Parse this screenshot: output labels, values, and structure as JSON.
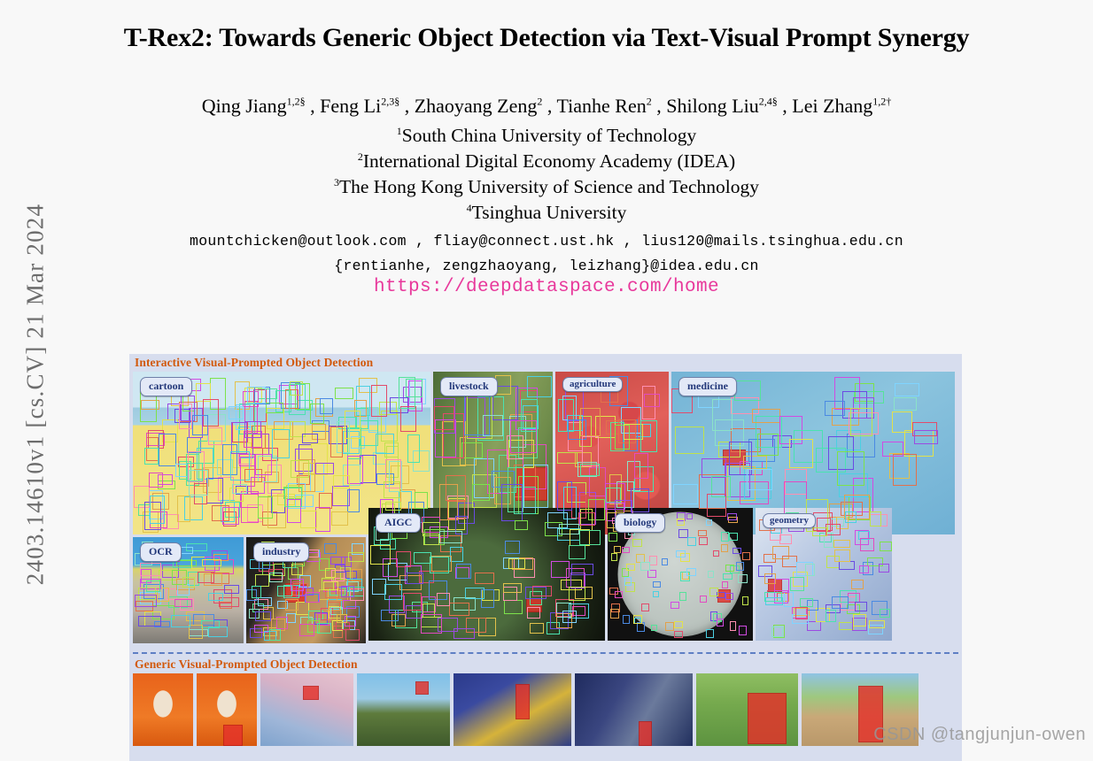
{
  "arxiv": {
    "stamp": "2403.14610v1  [cs.CV]  21 Mar 2024"
  },
  "paper": {
    "title": "T-Rex2: Towards Generic Object Detection via Text-Visual Prompt Synergy",
    "authors_line": "Qing Jiang1,2§ , Feng Li2,3§ , Zhaoyang Zeng2 , Tianhe Ren2 , Shilong Liu2,4§ , Lei Zhang1,2†",
    "authors": [
      {
        "name": "Qing Jiang",
        "sup": "1,2§"
      },
      {
        "name": "Feng Li",
        "sup": "2,3§"
      },
      {
        "name": "Zhaoyang Zeng",
        "sup": "2"
      },
      {
        "name": "Tianhe Ren",
        "sup": "2"
      },
      {
        "name": "Shilong Liu",
        "sup": "2,4§"
      },
      {
        "name": "Lei Zhang",
        "sup": "1,2†"
      }
    ],
    "affiliations": [
      {
        "sup": "1",
        "name": "South China University of Technology"
      },
      {
        "sup": "2",
        "name": "International Digital Economy Academy (IDEA)"
      },
      {
        "sup": "3",
        "name": "The Hong Kong University of Science and Technology"
      },
      {
        "sup": "4",
        "name": "Tsinghua University"
      }
    ],
    "emails_line1": "mountchicken@outlook.com , fliay@connect.ust.hk , lius120@mails.tsinghua.edu.cn",
    "emails_line2": "{rentianhe, zengzhaoyang, leizhang}@idea.edu.cn",
    "project_url": "https://deepdataspace.com/home",
    "url_color": "#e8389b"
  },
  "figure": {
    "background": "#d7ddee",
    "section_heading_color": "#d2590c",
    "chip_text_color": "#23387a",
    "sections": [
      {
        "heading": "Interactive Visual-Prompted Object Detection",
        "panels": [
          {
            "label": "cartoon"
          },
          {
            "label": "livestock"
          },
          {
            "label": "agriculture"
          },
          {
            "label": "medicine"
          },
          {
            "label": "OCR"
          },
          {
            "label": "industry"
          },
          {
            "label": "AIGC"
          },
          {
            "label": "biology"
          },
          {
            "label": "geometry"
          }
        ]
      },
      {
        "heading": "Generic Visual-Prompted Object Detection",
        "panels": []
      }
    ]
  },
  "watermark": {
    "text": "CSDN @tangjunjun-owen"
  }
}
